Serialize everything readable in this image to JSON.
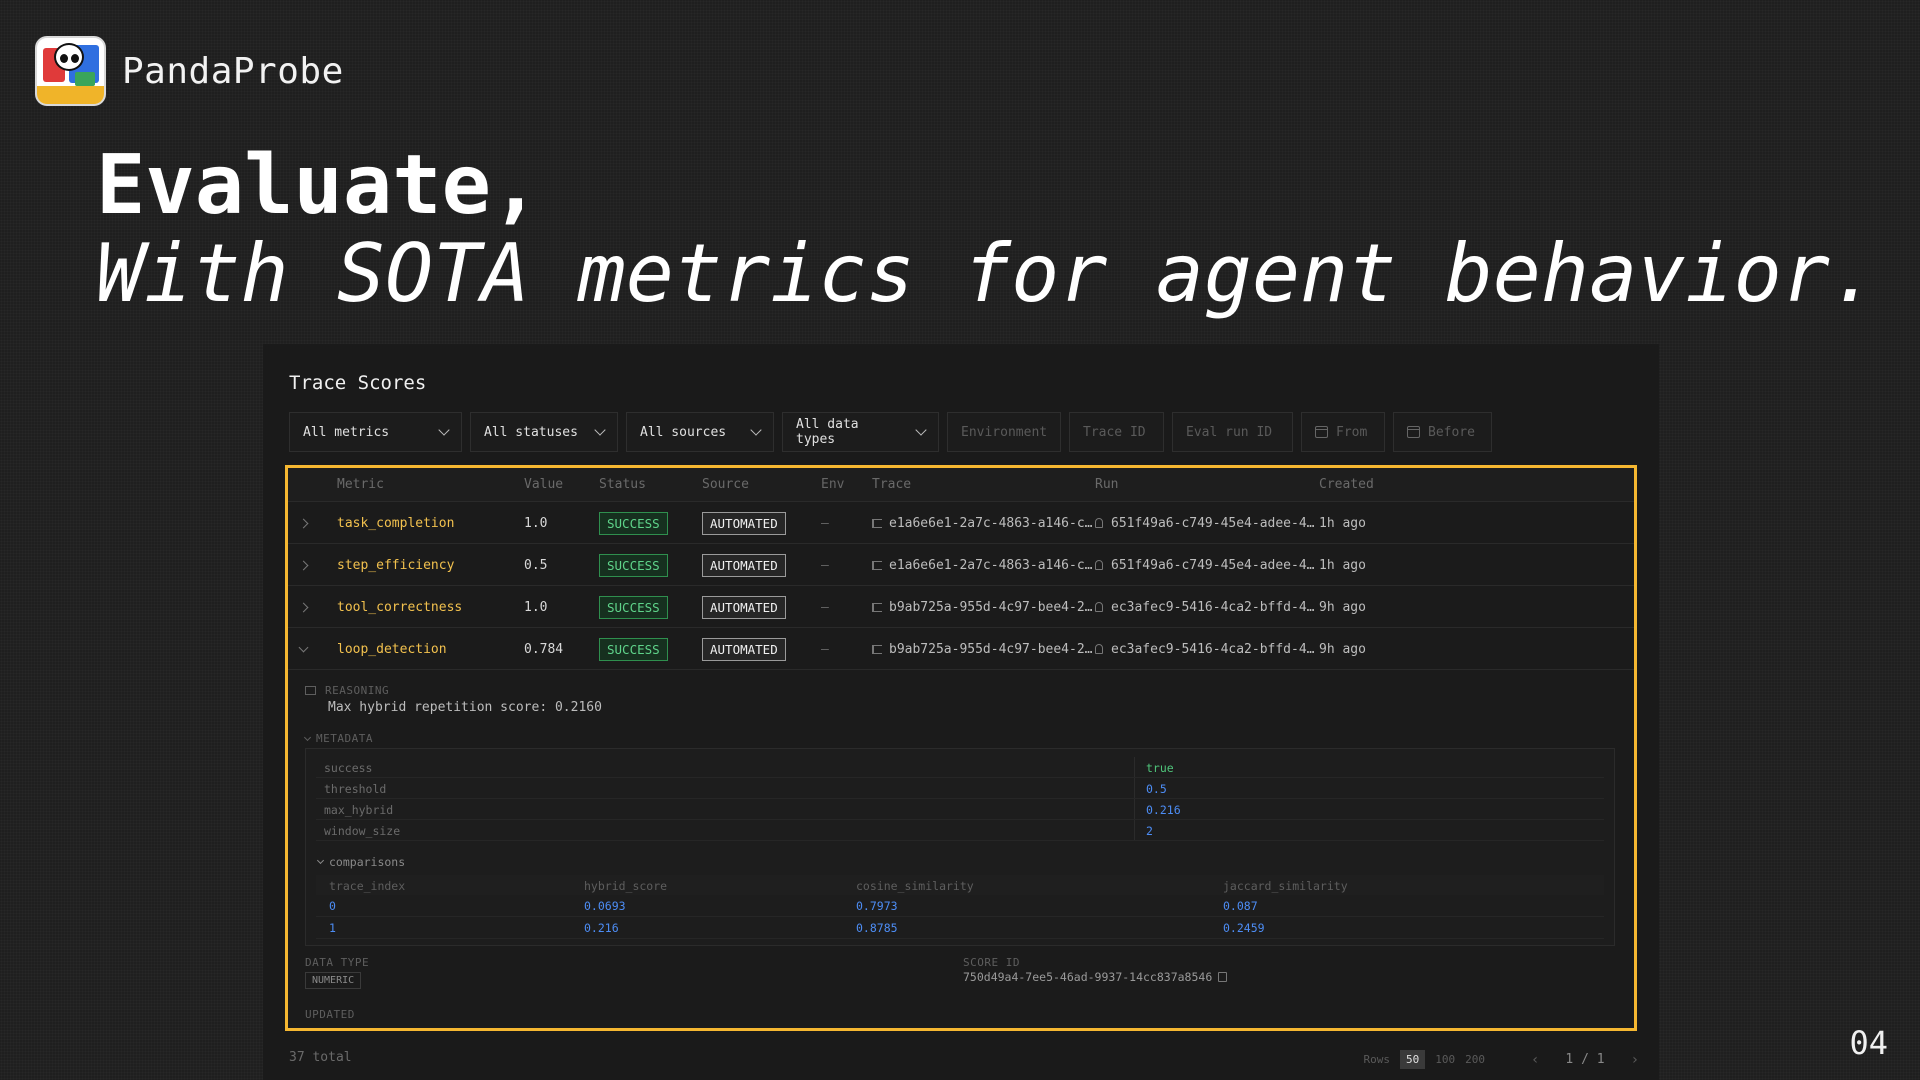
{
  "brand": {
    "name": "PandaProbe"
  },
  "headline": {
    "line1": "Evaluate,",
    "line2": "With SOTA metrics for agent behavior."
  },
  "page_number": "04",
  "panel": {
    "title": "Trace Scores",
    "filters": {
      "metrics": "All metrics",
      "statuses": "All statuses",
      "sources": "All sources",
      "data_types": "All data types",
      "environment": "Environment",
      "trace_id": "Trace ID",
      "eval_run_id": "Eval run ID",
      "from": "From",
      "before": "Before"
    },
    "columns": [
      "Metric",
      "Value",
      "Status",
      "Source",
      "Env",
      "Trace",
      "Run",
      "Created"
    ],
    "rows": [
      {
        "metric": "task_completion",
        "value": "1.0",
        "status": "SUCCESS",
        "source": "AUTOMATED",
        "env": "–",
        "trace": "e1a6e6e1-2a7c-4863-a146-c…",
        "run": "651f49a6-c749-45e4-adee-4…",
        "created": "1h ago"
      },
      {
        "metric": "step_efficiency",
        "value": "0.5",
        "status": "SUCCESS",
        "source": "AUTOMATED",
        "env": "–",
        "trace": "e1a6e6e1-2a7c-4863-a146-c…",
        "run": "651f49a6-c749-45e4-adee-4…",
        "created": "1h ago"
      },
      {
        "metric": "tool_correctness",
        "value": "1.0",
        "status": "SUCCESS",
        "source": "AUTOMATED",
        "env": "–",
        "trace": "b9ab725a-955d-4c97-bee4-2…",
        "run": "ec3afec9-5416-4ca2-bffd-4…",
        "created": "9h ago"
      },
      {
        "metric": "loop_detection",
        "value": "0.784",
        "status": "SUCCESS",
        "source": "AUTOMATED",
        "env": "–",
        "trace": "b9ab725a-955d-4c97-bee4-2…",
        "run": "ec3afec9-5416-4ca2-bffd-4…",
        "created": "9h ago"
      }
    ],
    "detail": {
      "reasoning_label": "REASONING",
      "reasoning_text": "Max hybrid repetition score: 0.2160",
      "metadata_label": "METADATA",
      "metadata": [
        {
          "key": "success",
          "value": "true"
        },
        {
          "key": "threshold",
          "value": "0.5"
        },
        {
          "key": "max_hybrid",
          "value": "0.216"
        },
        {
          "key": "window_size",
          "value": "2"
        }
      ],
      "comparisons_label": "comparisons",
      "comparison_headers": [
        "trace_index",
        "hybrid_score",
        "cosine_similarity",
        "jaccard_similarity"
      ],
      "comparisons": [
        [
          "0",
          "0.0693",
          "0.7973",
          "0.087"
        ],
        [
          "1",
          "0.216",
          "0.8785",
          "0.2459"
        ]
      ],
      "data_type_label": "DATA TYPE",
      "data_type": "NUMERIC",
      "score_id_label": "SCORE ID",
      "score_id": "750d49a4-7ee5-46ad-9937-14cc837a8546",
      "updated_label": "UPDATED"
    },
    "footer": {
      "total": "37 total",
      "rows_label": "Rows",
      "rows_options": [
        "50",
        "100",
        "200"
      ],
      "rows_selected": "50",
      "page": "1 / 1"
    }
  },
  "colors": {
    "accent_border": "#f5b731",
    "metric_text": "#f2c14e",
    "success": "#5fd38a",
    "link_blue": "#4d8df5"
  }
}
